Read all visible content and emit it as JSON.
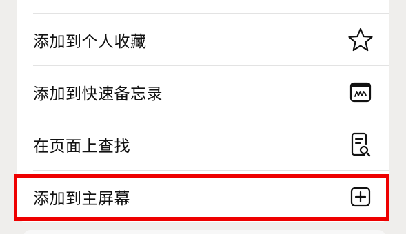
{
  "menu": {
    "items": [
      {
        "label": "添加到个人收藏",
        "icon": "star-icon"
      },
      {
        "label": "添加到快速备忘录",
        "icon": "quick-note-icon"
      },
      {
        "label": "在页面上查找",
        "icon": "find-in-page-icon"
      },
      {
        "label": "添加到主屏幕",
        "icon": "add-square-icon"
      }
    ]
  },
  "annotation": {
    "highlight_color": "#ee0000",
    "highlighted_item": "添加到主屏幕"
  }
}
